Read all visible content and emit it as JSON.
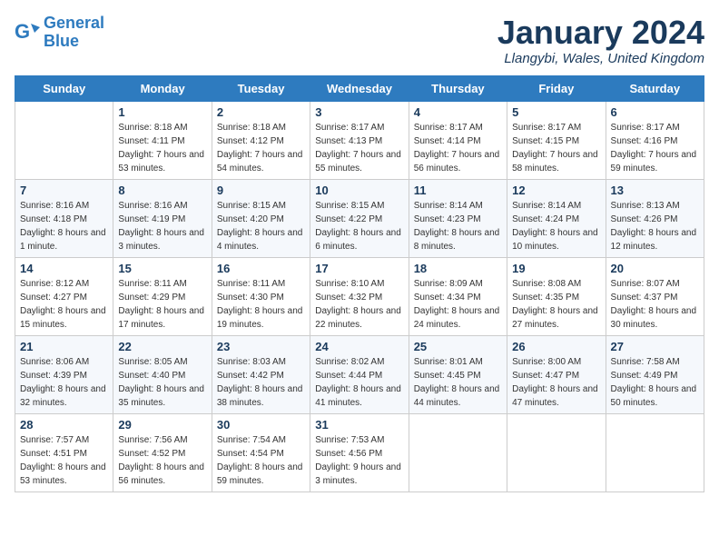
{
  "logo": {
    "line1": "General",
    "line2": "Blue"
  },
  "title": "January 2024",
  "location": "Llangybi, Wales, United Kingdom",
  "days_header": [
    "Sunday",
    "Monday",
    "Tuesday",
    "Wednesday",
    "Thursday",
    "Friday",
    "Saturday"
  ],
  "weeks": [
    [
      {
        "day": "",
        "sunrise": "",
        "sunset": "",
        "daylight": ""
      },
      {
        "day": "1",
        "sunrise": "Sunrise: 8:18 AM",
        "sunset": "Sunset: 4:11 PM",
        "daylight": "Daylight: 7 hours and 53 minutes."
      },
      {
        "day": "2",
        "sunrise": "Sunrise: 8:18 AM",
        "sunset": "Sunset: 4:12 PM",
        "daylight": "Daylight: 7 hours and 54 minutes."
      },
      {
        "day": "3",
        "sunrise": "Sunrise: 8:17 AM",
        "sunset": "Sunset: 4:13 PM",
        "daylight": "Daylight: 7 hours and 55 minutes."
      },
      {
        "day": "4",
        "sunrise": "Sunrise: 8:17 AM",
        "sunset": "Sunset: 4:14 PM",
        "daylight": "Daylight: 7 hours and 56 minutes."
      },
      {
        "day": "5",
        "sunrise": "Sunrise: 8:17 AM",
        "sunset": "Sunset: 4:15 PM",
        "daylight": "Daylight: 7 hours and 58 minutes."
      },
      {
        "day": "6",
        "sunrise": "Sunrise: 8:17 AM",
        "sunset": "Sunset: 4:16 PM",
        "daylight": "Daylight: 7 hours and 59 minutes."
      }
    ],
    [
      {
        "day": "7",
        "sunrise": "Sunrise: 8:16 AM",
        "sunset": "Sunset: 4:18 PM",
        "daylight": "Daylight: 8 hours and 1 minute."
      },
      {
        "day": "8",
        "sunrise": "Sunrise: 8:16 AM",
        "sunset": "Sunset: 4:19 PM",
        "daylight": "Daylight: 8 hours and 3 minutes."
      },
      {
        "day": "9",
        "sunrise": "Sunrise: 8:15 AM",
        "sunset": "Sunset: 4:20 PM",
        "daylight": "Daylight: 8 hours and 4 minutes."
      },
      {
        "day": "10",
        "sunrise": "Sunrise: 8:15 AM",
        "sunset": "Sunset: 4:22 PM",
        "daylight": "Daylight: 8 hours and 6 minutes."
      },
      {
        "day": "11",
        "sunrise": "Sunrise: 8:14 AM",
        "sunset": "Sunset: 4:23 PM",
        "daylight": "Daylight: 8 hours and 8 minutes."
      },
      {
        "day": "12",
        "sunrise": "Sunrise: 8:14 AM",
        "sunset": "Sunset: 4:24 PM",
        "daylight": "Daylight: 8 hours and 10 minutes."
      },
      {
        "day": "13",
        "sunrise": "Sunrise: 8:13 AM",
        "sunset": "Sunset: 4:26 PM",
        "daylight": "Daylight: 8 hours and 12 minutes."
      }
    ],
    [
      {
        "day": "14",
        "sunrise": "Sunrise: 8:12 AM",
        "sunset": "Sunset: 4:27 PM",
        "daylight": "Daylight: 8 hours and 15 minutes."
      },
      {
        "day": "15",
        "sunrise": "Sunrise: 8:11 AM",
        "sunset": "Sunset: 4:29 PM",
        "daylight": "Daylight: 8 hours and 17 minutes."
      },
      {
        "day": "16",
        "sunrise": "Sunrise: 8:11 AM",
        "sunset": "Sunset: 4:30 PM",
        "daylight": "Daylight: 8 hours and 19 minutes."
      },
      {
        "day": "17",
        "sunrise": "Sunrise: 8:10 AM",
        "sunset": "Sunset: 4:32 PM",
        "daylight": "Daylight: 8 hours and 22 minutes."
      },
      {
        "day": "18",
        "sunrise": "Sunrise: 8:09 AM",
        "sunset": "Sunset: 4:34 PM",
        "daylight": "Daylight: 8 hours and 24 minutes."
      },
      {
        "day": "19",
        "sunrise": "Sunrise: 8:08 AM",
        "sunset": "Sunset: 4:35 PM",
        "daylight": "Daylight: 8 hours and 27 minutes."
      },
      {
        "day": "20",
        "sunrise": "Sunrise: 8:07 AM",
        "sunset": "Sunset: 4:37 PM",
        "daylight": "Daylight: 8 hours and 30 minutes."
      }
    ],
    [
      {
        "day": "21",
        "sunrise": "Sunrise: 8:06 AM",
        "sunset": "Sunset: 4:39 PM",
        "daylight": "Daylight: 8 hours and 32 minutes."
      },
      {
        "day": "22",
        "sunrise": "Sunrise: 8:05 AM",
        "sunset": "Sunset: 4:40 PM",
        "daylight": "Daylight: 8 hours and 35 minutes."
      },
      {
        "day": "23",
        "sunrise": "Sunrise: 8:03 AM",
        "sunset": "Sunset: 4:42 PM",
        "daylight": "Daylight: 8 hours and 38 minutes."
      },
      {
        "day": "24",
        "sunrise": "Sunrise: 8:02 AM",
        "sunset": "Sunset: 4:44 PM",
        "daylight": "Daylight: 8 hours and 41 minutes."
      },
      {
        "day": "25",
        "sunrise": "Sunrise: 8:01 AM",
        "sunset": "Sunset: 4:45 PM",
        "daylight": "Daylight: 8 hours and 44 minutes."
      },
      {
        "day": "26",
        "sunrise": "Sunrise: 8:00 AM",
        "sunset": "Sunset: 4:47 PM",
        "daylight": "Daylight: 8 hours and 47 minutes."
      },
      {
        "day": "27",
        "sunrise": "Sunrise: 7:58 AM",
        "sunset": "Sunset: 4:49 PM",
        "daylight": "Daylight: 8 hours and 50 minutes."
      }
    ],
    [
      {
        "day": "28",
        "sunrise": "Sunrise: 7:57 AM",
        "sunset": "Sunset: 4:51 PM",
        "daylight": "Daylight: 8 hours and 53 minutes."
      },
      {
        "day": "29",
        "sunrise": "Sunrise: 7:56 AM",
        "sunset": "Sunset: 4:52 PM",
        "daylight": "Daylight: 8 hours and 56 minutes."
      },
      {
        "day": "30",
        "sunrise": "Sunrise: 7:54 AM",
        "sunset": "Sunset: 4:54 PM",
        "daylight": "Daylight: 8 hours and 59 minutes."
      },
      {
        "day": "31",
        "sunrise": "Sunrise: 7:53 AM",
        "sunset": "Sunset: 4:56 PM",
        "daylight": "Daylight: 9 hours and 3 minutes."
      },
      {
        "day": "",
        "sunrise": "",
        "sunset": "",
        "daylight": ""
      },
      {
        "day": "",
        "sunrise": "",
        "sunset": "",
        "daylight": ""
      },
      {
        "day": "",
        "sunrise": "",
        "sunset": "",
        "daylight": ""
      }
    ]
  ]
}
